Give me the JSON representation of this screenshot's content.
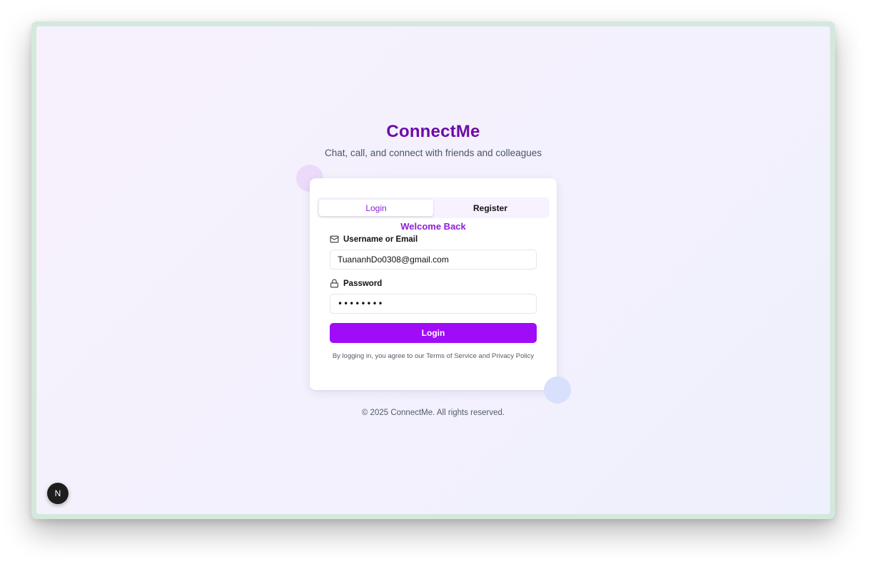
{
  "header": {
    "title": "ConnectMe",
    "subtitle": "Chat, call, and connect with friends and colleagues"
  },
  "tabs": [
    {
      "label": "Login",
      "active": true
    },
    {
      "label": "Register",
      "active": false
    }
  ],
  "form": {
    "heading": "Welcome Back",
    "username_label": "Username or Email",
    "username_icon": "mail-icon",
    "username_value": "TuananhDo0308@gmail.com",
    "password_label": "Password",
    "password_icon": "lock-icon",
    "password_value": "••••••••",
    "submit_label": "Login",
    "terms_text": "By logging in, you agree to our Terms of Service and Privacy Policy"
  },
  "footer": {
    "copyright": "© 2025 ConnectMe. All rights reserved."
  },
  "dev_badge": {
    "icon": "nextjs-icon",
    "label": "N"
  },
  "colors": {
    "brand": "#6d0aa9",
    "accent": "#a00cf7",
    "tab_active_text": "#8d1fd6"
  }
}
